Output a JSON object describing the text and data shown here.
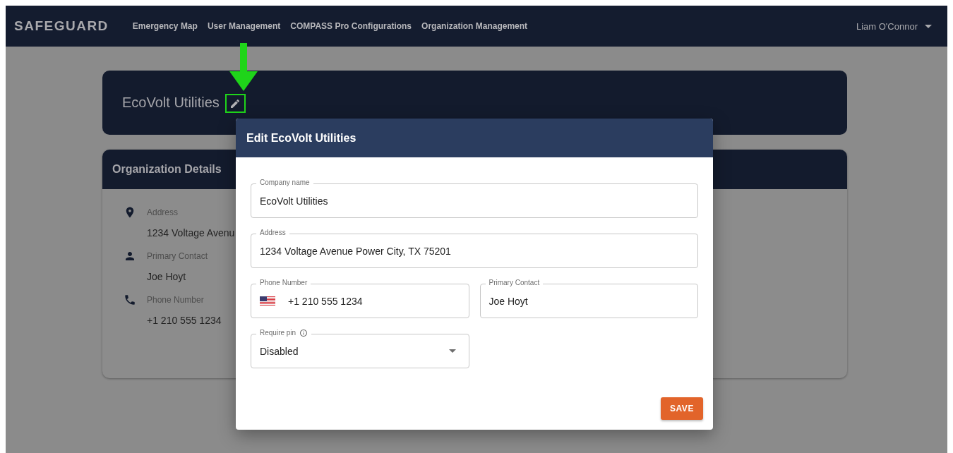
{
  "header": {
    "logo": "SAFEGUARD",
    "nav": [
      "Emergency Map",
      "User Management",
      "COMPASS Pro Configurations",
      "Organization Management"
    ],
    "user": "Liam O'Connor"
  },
  "organization": {
    "name": "EcoVolt Utilities",
    "details_title": "Organization Details",
    "details": [
      {
        "kind": "address",
        "label": "Address",
        "value": "1234 Voltage Avenu"
      },
      {
        "kind": "contact",
        "label": "Primary Contact",
        "value": "Joe Hoyt"
      },
      {
        "kind": "phone",
        "label": "Phone Number",
        "value": "+1 210 555 1234"
      }
    ]
  },
  "dialog": {
    "title": "Edit EcoVolt Utilities",
    "rows": [
      [
        {
          "kind": "text",
          "label": "Company name",
          "value": "EcoVolt Utilities"
        }
      ],
      [
        {
          "kind": "text",
          "label": "Address",
          "value": "1234 Voltage Avenue Power City, TX 75201"
        }
      ],
      [
        {
          "kind": "phone",
          "label": "Phone Number",
          "value": "+1 210 555 1234"
        },
        {
          "kind": "text",
          "label": "Primary Contact",
          "value": "Joe Hoyt"
        }
      ],
      [
        {
          "kind": "select",
          "label": "Require pin",
          "value": "Disabled"
        }
      ]
    ],
    "save": "SAVE"
  }
}
